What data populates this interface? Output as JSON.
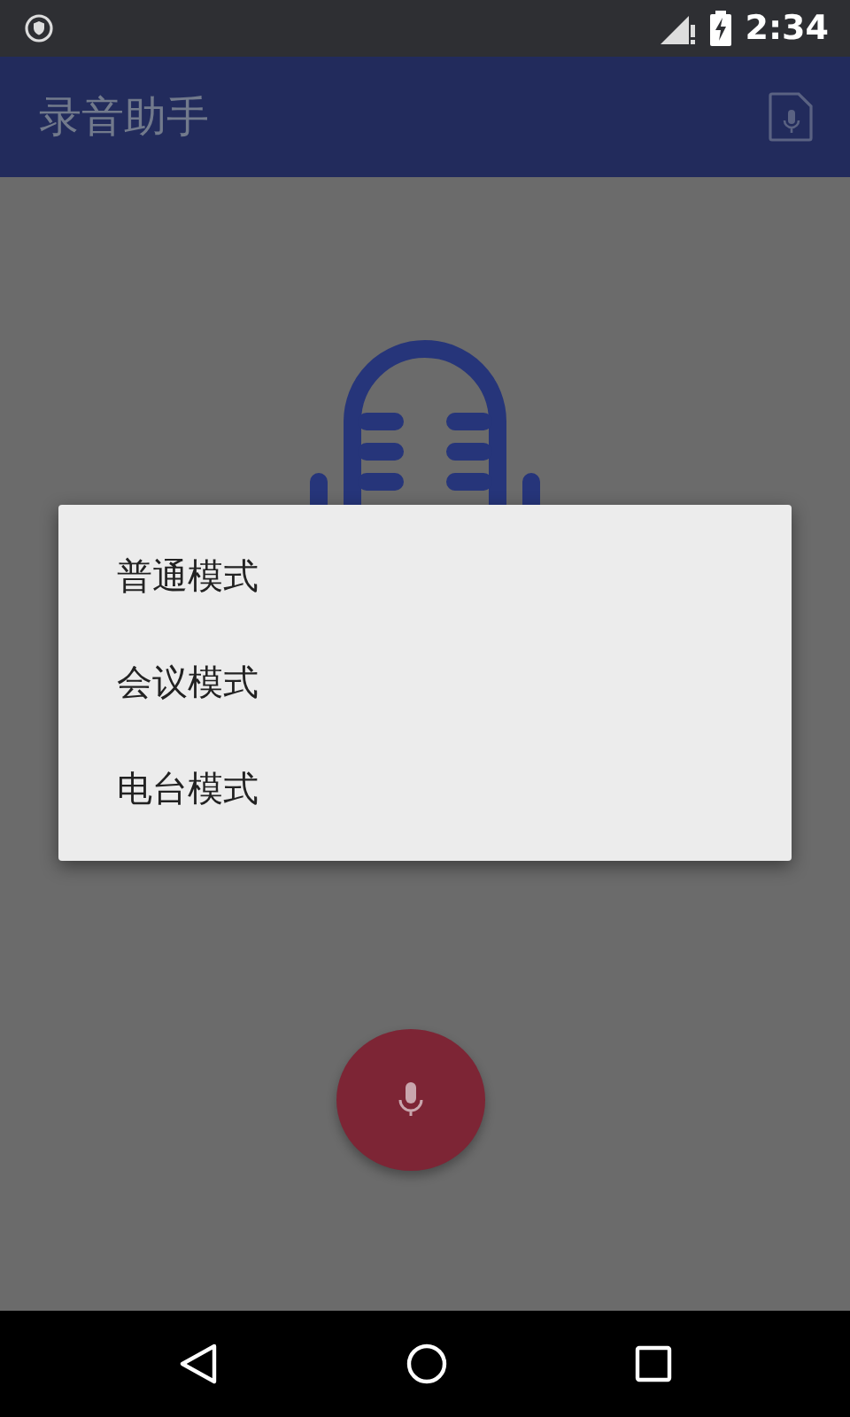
{
  "status_bar": {
    "time": "2:34"
  },
  "app_bar": {
    "title": "录音助手"
  },
  "dialog": {
    "options": [
      {
        "label": "普通模式"
      },
      {
        "label": "会议模式"
      },
      {
        "label": "电台模式"
      }
    ]
  }
}
